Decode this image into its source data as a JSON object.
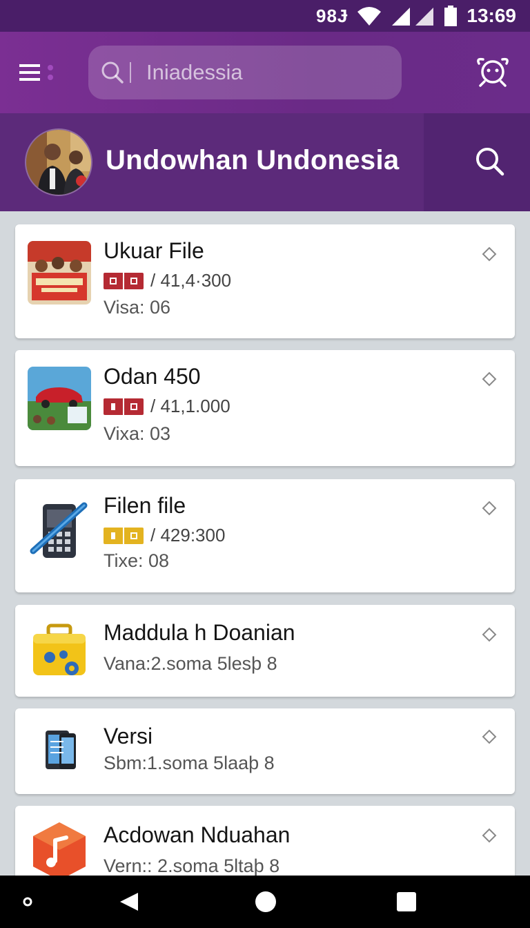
{
  "status_bar": {
    "carrier": "98Ɉ",
    "time": "13:69"
  },
  "top_bar": {
    "search_placeholder": "Iniadessia"
  },
  "profile": {
    "name": "Undowhan Undonesia"
  },
  "items": [
    {
      "title": "Ukuar File",
      "meta": "/ 41,4·300",
      "sub": "Visa:  06",
      "badge_color": "#b52a33",
      "thumb": "poster"
    },
    {
      "title": "Odan 450",
      "meta": "/ 41,1.000",
      "sub": "Vixa:  03",
      "badge_color": "#b52a33",
      "thumb": "car"
    },
    {
      "title": "Filen file",
      "meta": "/ 429:300",
      "sub": "Tixe:  08",
      "badge_color": "#e3b320",
      "thumb": "phone"
    },
    {
      "title": "Maddula h Doanian",
      "sub": "Vana:2.soma 5lesþ 8",
      "thumb": "toolbox"
    },
    {
      "title": "Versi",
      "sub": "Sbm:1.soma 5laaþ 8",
      "thumb": "tablet"
    },
    {
      "title": "Acdowan Nduahan",
      "sub": "Vern:: 2.soma 5ltaþ 8",
      "thumb": "hex"
    }
  ],
  "colors": {
    "status_bg": "#4a1e68",
    "app_bar": "#7b2f93",
    "profile_bg": "#5c2a7a",
    "list_bg": "#d3d8dc"
  },
  "icons": [
    "menu-icon",
    "search-icon",
    "planet-icon",
    "more-icon",
    "back-icon",
    "home-icon",
    "recents-icon"
  ]
}
